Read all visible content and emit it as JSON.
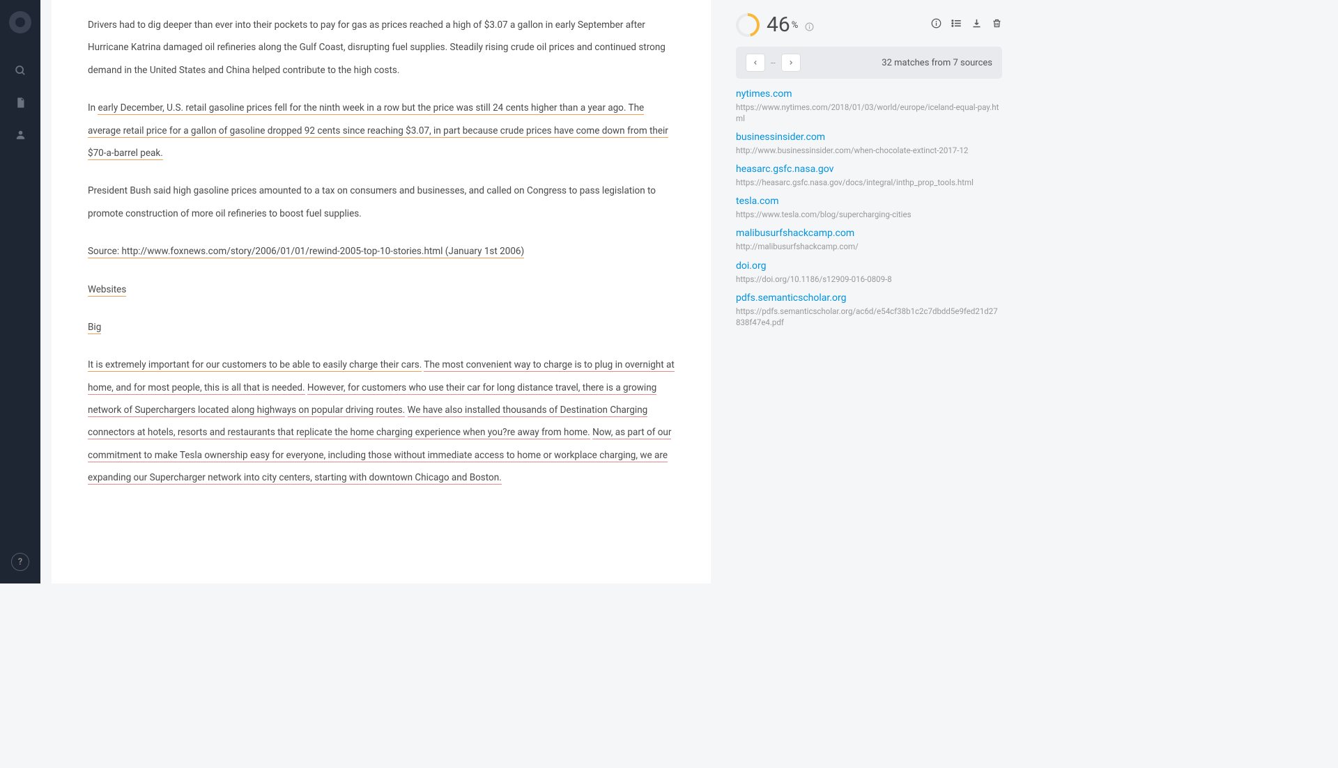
{
  "score": {
    "value": "46",
    "unit": "%"
  },
  "nav": {
    "sep": "--",
    "summary": "32 matches from 7 sources"
  },
  "doc": {
    "p1": "Drivers had to dig deeper than ever into their pockets to pay for gas as prices reached a high of $3.07 a gallon in early September after Hurricane Katrina damaged oil refineries along the Gulf Coast, disrupting fuel supplies. Steadily rising crude oil prices and continued strong demand in the United States and China helped contribute to the high costs.",
    "p2a": "In ",
    "p2b": "early December, U.S. retail gasoline prices fell for the ninth week in a row but the price was still 24 cents higher than a year ago. The average retail price for a gallon of gasoline dropped 92 cents since reaching $3.07, in part because crude prices have come down from their $70-a-barrel peak.",
    "p3": "President Bush said high gasoline prices amounted to a tax on consumers and businesses, and called on Congress to pass legislation to promote construction of more oil refineries to boost fuel supplies.",
    "p4": "Source: http://www.foxnews.com/story/2006/01/01/rewind-2005-top-10-stories.html (January 1st 2006)",
    "p5": "Websites",
    "p6": "Big",
    "p7a": "It is extremely important for our customers to be able to easily charge their cars.",
    "p7b": "The most convenient way to charge is to plug in overnight at home, and for most people, this is all that is needed.",
    "p7c": "However, for customers who use their car for long distance travel, there is a growing network of Superchargers located along highways on popular driving routes.",
    "p7d": "We have also installed thousands of Destination Charging connectors at hotels, resorts and restaurants that replicate the home charging experience when you?re away from home.",
    "p7e": "Now, as part of our commitment to make Tesla ownership easy for everyone, including those without immediate access to home or workplace charging, we are expanding our Supercharger network into city centers, starting with downtown Chicago and Boston."
  },
  "sources": [
    {
      "name": "nytimes.com",
      "url": "https://www.nytimes.com/2018/01/03/world/europe/iceland-equal-pay.html"
    },
    {
      "name": "businessinsider.com",
      "url": "http://www.businessinsider.com/when-chocolate-extinct-2017-12"
    },
    {
      "name": "heasarc.gsfc.nasa.gov",
      "url": "https://heasarc.gsfc.nasa.gov/docs/integral/inthp_prop_tools.html"
    },
    {
      "name": "tesla.com",
      "url": "https://www.tesla.com/blog/supercharging-cities"
    },
    {
      "name": "malibusurfshackcamp.com",
      "url": "http://malibusurfshackcamp.com/"
    },
    {
      "name": "doi.org",
      "url": "https://doi.org/10.1186/s12909-016-0809-8"
    },
    {
      "name": "pdfs.semanticscholar.org",
      "url": "https://pdfs.semanticscholar.org/ac6d/e54cf38b1c2c7dbdd5e9fed21d27838f47e4.pdf"
    }
  ]
}
